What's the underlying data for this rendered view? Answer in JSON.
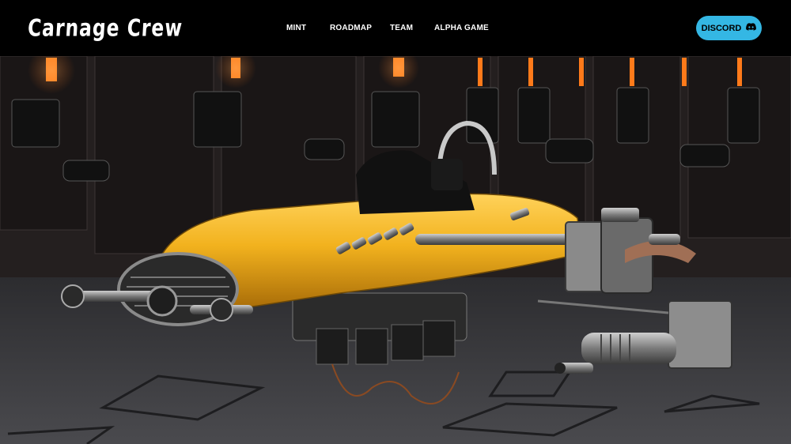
{
  "brand": {
    "logo_text": "Carnage Crew"
  },
  "nav": {
    "links": [
      {
        "label": "MINT"
      },
      {
        "label": "ROADMAP"
      },
      {
        "label": "TEAM"
      },
      {
        "label": "ALPHA GAME"
      }
    ],
    "discord_label": "DISCORD",
    "discord_icon": "discord-icon"
  },
  "hero": {
    "image_description_icon": "hovercar-render",
    "colors": {
      "car_body": "#f2b21e",
      "wall_light": "#ff7a1a",
      "button": "#34b7e4"
    }
  }
}
